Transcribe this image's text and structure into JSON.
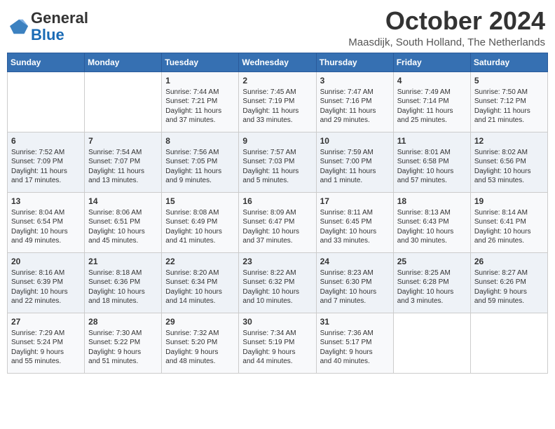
{
  "logo": {
    "text_general": "General",
    "text_blue": "Blue"
  },
  "header": {
    "month": "October 2024",
    "location": "Maasdijk, South Holland, The Netherlands"
  },
  "weekdays": [
    "Sunday",
    "Monday",
    "Tuesday",
    "Wednesday",
    "Thursday",
    "Friday",
    "Saturday"
  ],
  "weeks": [
    [
      {
        "day": "",
        "info": ""
      },
      {
        "day": "",
        "info": ""
      },
      {
        "day": "1",
        "info": "Sunrise: 7:44 AM\nSunset: 7:21 PM\nDaylight: 11 hours\nand 37 minutes."
      },
      {
        "day": "2",
        "info": "Sunrise: 7:45 AM\nSunset: 7:19 PM\nDaylight: 11 hours\nand 33 minutes."
      },
      {
        "day": "3",
        "info": "Sunrise: 7:47 AM\nSunset: 7:16 PM\nDaylight: 11 hours\nand 29 minutes."
      },
      {
        "day": "4",
        "info": "Sunrise: 7:49 AM\nSunset: 7:14 PM\nDaylight: 11 hours\nand 25 minutes."
      },
      {
        "day": "5",
        "info": "Sunrise: 7:50 AM\nSunset: 7:12 PM\nDaylight: 11 hours\nand 21 minutes."
      }
    ],
    [
      {
        "day": "6",
        "info": "Sunrise: 7:52 AM\nSunset: 7:09 PM\nDaylight: 11 hours\nand 17 minutes."
      },
      {
        "day": "7",
        "info": "Sunrise: 7:54 AM\nSunset: 7:07 PM\nDaylight: 11 hours\nand 13 minutes."
      },
      {
        "day": "8",
        "info": "Sunrise: 7:56 AM\nSunset: 7:05 PM\nDaylight: 11 hours\nand 9 minutes."
      },
      {
        "day": "9",
        "info": "Sunrise: 7:57 AM\nSunset: 7:03 PM\nDaylight: 11 hours\nand 5 minutes."
      },
      {
        "day": "10",
        "info": "Sunrise: 7:59 AM\nSunset: 7:00 PM\nDaylight: 11 hours\nand 1 minute."
      },
      {
        "day": "11",
        "info": "Sunrise: 8:01 AM\nSunset: 6:58 PM\nDaylight: 10 hours\nand 57 minutes."
      },
      {
        "day": "12",
        "info": "Sunrise: 8:02 AM\nSunset: 6:56 PM\nDaylight: 10 hours\nand 53 minutes."
      }
    ],
    [
      {
        "day": "13",
        "info": "Sunrise: 8:04 AM\nSunset: 6:54 PM\nDaylight: 10 hours\nand 49 minutes."
      },
      {
        "day": "14",
        "info": "Sunrise: 8:06 AM\nSunset: 6:51 PM\nDaylight: 10 hours\nand 45 minutes."
      },
      {
        "day": "15",
        "info": "Sunrise: 8:08 AM\nSunset: 6:49 PM\nDaylight: 10 hours\nand 41 minutes."
      },
      {
        "day": "16",
        "info": "Sunrise: 8:09 AM\nSunset: 6:47 PM\nDaylight: 10 hours\nand 37 minutes."
      },
      {
        "day": "17",
        "info": "Sunrise: 8:11 AM\nSunset: 6:45 PM\nDaylight: 10 hours\nand 33 minutes."
      },
      {
        "day": "18",
        "info": "Sunrise: 8:13 AM\nSunset: 6:43 PM\nDaylight: 10 hours\nand 30 minutes."
      },
      {
        "day": "19",
        "info": "Sunrise: 8:14 AM\nSunset: 6:41 PM\nDaylight: 10 hours\nand 26 minutes."
      }
    ],
    [
      {
        "day": "20",
        "info": "Sunrise: 8:16 AM\nSunset: 6:39 PM\nDaylight: 10 hours\nand 22 minutes."
      },
      {
        "day": "21",
        "info": "Sunrise: 8:18 AM\nSunset: 6:36 PM\nDaylight: 10 hours\nand 18 minutes."
      },
      {
        "day": "22",
        "info": "Sunrise: 8:20 AM\nSunset: 6:34 PM\nDaylight: 10 hours\nand 14 minutes."
      },
      {
        "day": "23",
        "info": "Sunrise: 8:22 AM\nSunset: 6:32 PM\nDaylight: 10 hours\nand 10 minutes."
      },
      {
        "day": "24",
        "info": "Sunrise: 8:23 AM\nSunset: 6:30 PM\nDaylight: 10 hours\nand 7 minutes."
      },
      {
        "day": "25",
        "info": "Sunrise: 8:25 AM\nSunset: 6:28 PM\nDaylight: 10 hours\nand 3 minutes."
      },
      {
        "day": "26",
        "info": "Sunrise: 8:27 AM\nSunset: 6:26 PM\nDaylight: 9 hours\nand 59 minutes."
      }
    ],
    [
      {
        "day": "27",
        "info": "Sunrise: 7:29 AM\nSunset: 5:24 PM\nDaylight: 9 hours\nand 55 minutes."
      },
      {
        "day": "28",
        "info": "Sunrise: 7:30 AM\nSunset: 5:22 PM\nDaylight: 9 hours\nand 51 minutes."
      },
      {
        "day": "29",
        "info": "Sunrise: 7:32 AM\nSunset: 5:20 PM\nDaylight: 9 hours\nand 48 minutes."
      },
      {
        "day": "30",
        "info": "Sunrise: 7:34 AM\nSunset: 5:19 PM\nDaylight: 9 hours\nand 44 minutes."
      },
      {
        "day": "31",
        "info": "Sunrise: 7:36 AM\nSunset: 5:17 PM\nDaylight: 9 hours\nand 40 minutes."
      },
      {
        "day": "",
        "info": ""
      },
      {
        "day": "",
        "info": ""
      }
    ]
  ]
}
